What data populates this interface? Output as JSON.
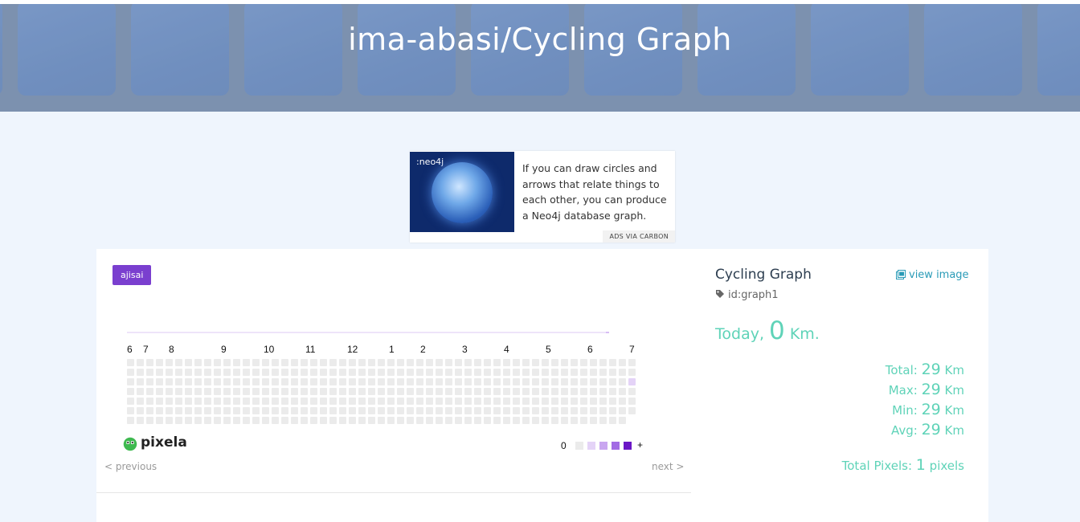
{
  "header": {
    "title": "ima-abasi/Cycling Graph"
  },
  "ad": {
    "logo_text": ":neo4j",
    "text": "If you can draw circles and arrows that relate things to each other, you can produce a Neo4j database graph.",
    "via": "ADS VIA CARBON"
  },
  "graph_card": {
    "badge": "ajisai",
    "months": [
      "6",
      "7",
      "8",
      "9",
      "10",
      "11",
      "12",
      "1",
      "2",
      "3",
      "4",
      "5",
      "6",
      "7"
    ],
    "legend_min": "0",
    "legend_max": "+",
    "legend_colors": [
      "#ebebeb",
      "#e4d3f7",
      "#c9a6f0",
      "#a26be4",
      "#6b17c6"
    ],
    "empty_color": "#ebebeb",
    "pixel_color": "#e4d3f7",
    "pixela_brand": "pixela",
    "prev_label": "< previous",
    "next_label": "next >"
  },
  "info": {
    "graph_name": "Cycling Graph",
    "view_image_label": "view image",
    "graph_id": "id:graph1",
    "today_prefix": "Today",
    "today_value": "0",
    "today_unit": "Km.",
    "stats": [
      {
        "label": "Total:",
        "value": "29",
        "unit": "Km"
      },
      {
        "label": "Max:",
        "value": "29",
        "unit": "Km"
      },
      {
        "label": "Min:",
        "value": "29",
        "unit": "Km"
      },
      {
        "label": "Avg:",
        "value": "29",
        "unit": "Km"
      }
    ],
    "total_pixels_label": "Total Pixels:",
    "total_pixels_value": "1",
    "total_pixels_unit": "pixels",
    "accent_color": "#5fd3b8",
    "link_color": "#2a9bb7"
  }
}
